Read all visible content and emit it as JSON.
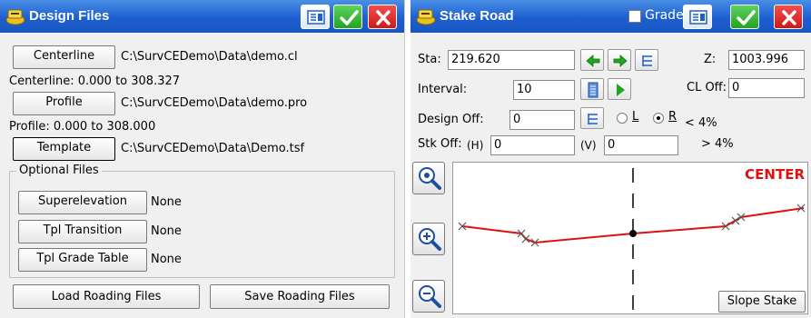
{
  "left": {
    "title": "Design Files",
    "centerline_button": "Centerline",
    "centerline_path": "C:\\SurvCEDemo\\Data\\demo.cl",
    "centerline_range": "Centerline: 0.000 to 308.327",
    "profile_button": "Profile",
    "profile_path": "C:\\SurvCEDemo\\Data\\demo.pro",
    "profile_range": "Profile: 0.000 to 308.000",
    "template_button": "Template",
    "template_path": "C:\\SurvCEDemo\\Data\\Demo.tsf",
    "optional_files_label": "Optional Files",
    "superelevation_button": "Superelevation",
    "superelevation_value": "None",
    "tpl_transition_button": "Tpl Transition",
    "tpl_transition_value": "None",
    "tpl_grade_table_button": "Tpl Grade Table",
    "tpl_grade_table_value": "None",
    "load_button": "Load Roading Files",
    "save_button": "Save Roading Files"
  },
  "right": {
    "title": "Stake Road",
    "grade_label": "Grade",
    "sta_label": "Sta:",
    "sta_value": "219.620",
    "z_label": "Z:",
    "z_value": "1003.996",
    "interval_label": "Interval:",
    "interval_value": "10",
    "cl_off_label": "CL Off:",
    "cl_off_value": "0",
    "design_off_label": "Design Off:",
    "design_off_value": "0",
    "radio_l_label": "L",
    "radio_r_label": "R",
    "selected_side": "R",
    "stk_off_label": "Stk Off:",
    "h_label": "(H)",
    "h_value": "0",
    "v_label": "(V)",
    "v_value": "0",
    "slope_lt": "< 4%",
    "slope_gt": "> 4%",
    "center_label": "CENTER",
    "slope_stake_button": "Slope Stake"
  },
  "colors": {
    "title_bar": "#1d5fd0",
    "ok_green": "#22a322",
    "close_red": "#d01818",
    "profile_line": "#e01010",
    "center_text": "#e01010",
    "arrow_green": "#1fa51f"
  },
  "icons": {
    "title_icon": "roading-tool-icon",
    "keyboard": "keyboard-icon",
    "ok": "checkmark-icon",
    "close": "close-icon",
    "prev": "arrow-left-icon",
    "next": "arrow-right-icon",
    "list": "list-icon",
    "calc": "calculator-icon",
    "play": "play-icon",
    "zoom_extents": "zoom-extents-icon",
    "zoom_in": "zoom-in-icon",
    "zoom_out": "zoom-out-icon"
  }
}
